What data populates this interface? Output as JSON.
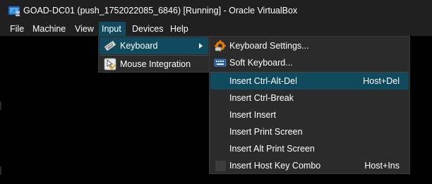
{
  "window": {
    "title": "GOAD-DC01 (push_1752022085_6846) [Running] - Oracle VirtualBox",
    "icon": "virtualbox-icon"
  },
  "menubar": {
    "items": [
      {
        "label": "File"
      },
      {
        "label": "Machine"
      },
      {
        "label": "View"
      },
      {
        "label": "Input",
        "active": true
      },
      {
        "label": "Devices"
      },
      {
        "label": "Help"
      }
    ]
  },
  "input_menu": {
    "items": [
      {
        "label": "Keyboard",
        "icon": "keyboard-icon",
        "has_submenu": true,
        "highlighted": true
      },
      {
        "label": "Mouse Integration",
        "icon": "mouse-integration-icon",
        "checked": true
      }
    ]
  },
  "keyboard_submenu": {
    "items": [
      {
        "label": "Keyboard Settings...",
        "icon": "keyboard-settings-icon"
      },
      {
        "label": "Soft Keyboard...",
        "icon": "soft-keyboard-icon"
      },
      {
        "label": "Insert Ctrl-Alt-Del",
        "shortcut": "Host+Del",
        "highlighted": true
      },
      {
        "label": "Insert Ctrl-Break"
      },
      {
        "label": "Insert Insert"
      },
      {
        "label": "Insert Print Screen"
      },
      {
        "label": "Insert Alt Print Screen"
      },
      {
        "label": "Insert Host Key Combo",
        "shortcut": "Host+Ins",
        "checkbox": true
      }
    ]
  },
  "colors": {
    "titlebar_bg": "#202020",
    "menu_bg": "#2b2b2b",
    "highlight": "#0f4a5e",
    "viewport_bg": "#000000"
  }
}
